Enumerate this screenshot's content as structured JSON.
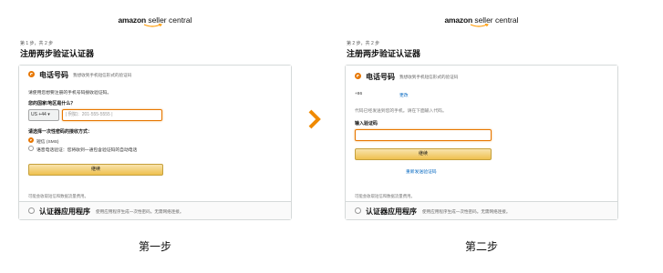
{
  "step1": {
    "logo_brand": "amazon",
    "logo_rest": "seller central",
    "step_label": "第 1 步，共 2 步",
    "heading": "注册两步验证认证器",
    "phone_title": "电话号码",
    "phone_desc": "我想收到手机短信形式的验证码",
    "intro": "请使用您想要注册的手机号码接收验证码。",
    "country_label": "您的国家/地区是什么？",
    "country_value": "US +44 ▾",
    "phone_placeholder": "| 例如：201-555-5555 |",
    "method_label": "请选择一次性密码的接收方式：",
    "method_sms": "短信 (SMS)",
    "method_voice": "语音电话验证：您将收到一通包含验证码的自动电话",
    "continue_btn": "继续",
    "footer_note": "可能会收取短信和数据流量费用。",
    "app_title": "认证器应用程序",
    "app_desc": "使用应用程序生成一次性密码。无需网络连接。",
    "caption": "第一步"
  },
  "step2": {
    "logo_brand": "amazon",
    "logo_rest": "seller central",
    "step_label": "第 2 步，共 2 步",
    "heading": "注册两步验证认证器",
    "phone_title": "电话号码",
    "phone_desc": "我想收到手机短信形式的验证码",
    "country_code": "+86",
    "change_link": "更改",
    "sent_note": "代码已经发送到您的手机。请在下面输入代码。",
    "code_label": "输入验证码",
    "code_value": "",
    "continue_btn": "继续",
    "resend_link": "重新发送验证码",
    "footer_note": "可能会收取短信和数据流量费用。",
    "app_title": "认证器应用程序",
    "app_desc": "使用应用程序生成一次性密码。无需网络连接。",
    "caption": "第二步"
  },
  "colors": {
    "accent": "#e77600",
    "button": "#f0c14b",
    "link": "#0066c0",
    "arrow": "#f08a00"
  },
  "icons": {
    "arrow": "chevron-right-icon"
  }
}
